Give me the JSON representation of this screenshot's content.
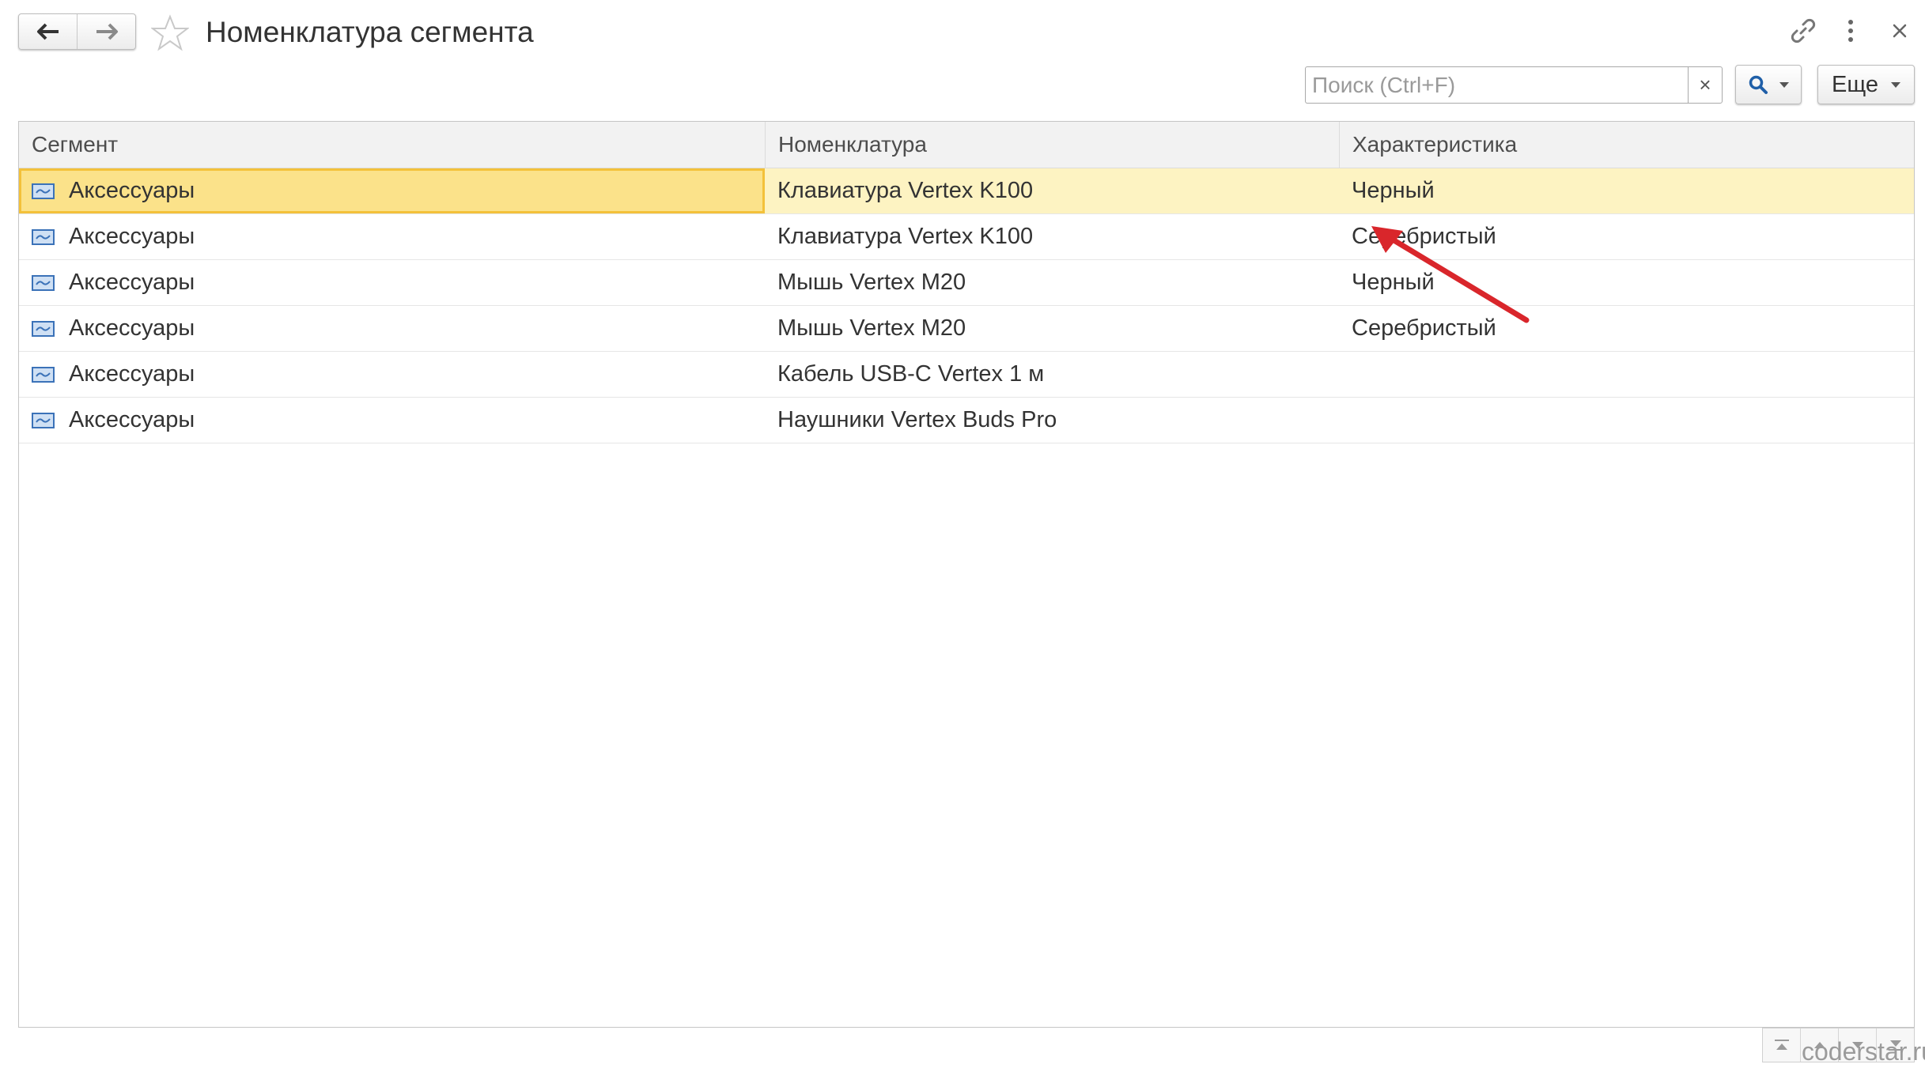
{
  "window": {
    "title": "Номенклатура сегмента"
  },
  "toolbar": {
    "search_placeholder": "Поиск (Ctrl+F)",
    "search_clear_label": "×",
    "more_label": "Еще"
  },
  "table": {
    "columns": [
      "Сегмент",
      "Номенклатура",
      "Характеристика"
    ],
    "rows": [
      [
        "Аксессуары",
        "Клавиатура Vertex K100",
        "Черный"
      ],
      [
        "Аксессуары",
        "Клавиатура Vertex K100",
        "Серебристый"
      ],
      [
        "Аксессуары",
        "Мышь Vertex M20",
        "Черный"
      ],
      [
        "Аксессуары",
        "Мышь Vertex M20",
        "Серебристый"
      ],
      [
        "Аксессуары",
        "Кабель USB-C Vertex 1 м",
        ""
      ],
      [
        "Аксессуары",
        "Наушники Vertex Buds Pro",
        ""
      ]
    ]
  },
  "watermark": "coderstar.ru",
  "colors": {
    "selected_row": "#fdf3c2",
    "selected_cell": "#fbe28a",
    "selected_border": "#f3c13a",
    "annotation_arrow": "#d9262b"
  },
  "icons": [
    "back-arrow-icon",
    "forward-arrow-icon",
    "star-icon",
    "link-icon",
    "more-vertical-icon",
    "close-icon",
    "search-icon",
    "segment-icon",
    "page-first-icon",
    "page-up-icon",
    "page-down-icon",
    "page-last-icon"
  ]
}
